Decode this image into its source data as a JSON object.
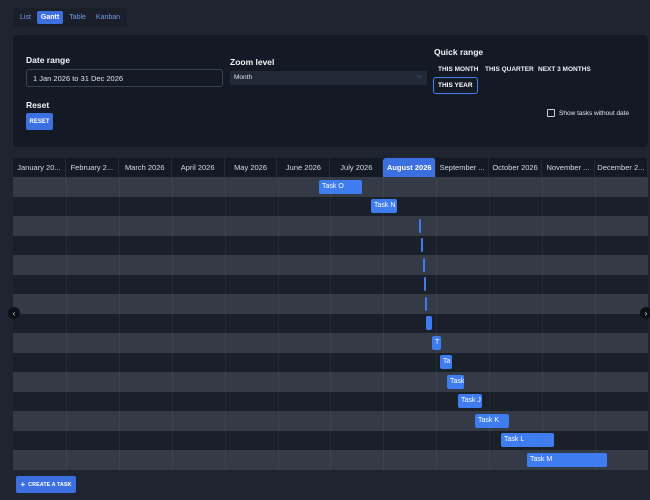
{
  "view_tabs": [
    {
      "label": "List",
      "active": false
    },
    {
      "label": "Gantt",
      "active": true
    },
    {
      "label": "Table",
      "active": false
    },
    {
      "label": "Kanban",
      "active": false
    }
  ],
  "controls": {
    "date_range_label": "Date range",
    "date_range_value": "1 Jan 2026 to 31 Dec 2026",
    "zoom_label": "Zoom level",
    "zoom_value": "Month",
    "quick_range_label": "Quick range",
    "quick_ranges": [
      "THIS MONTH",
      "THIS QUARTER",
      "NEXT 3 MONTHS",
      "THIS YEAR"
    ],
    "quick_range_selected": "THIS YEAR",
    "reset_label": "Reset",
    "reset_button": "RESET",
    "show_tasks_without_date": "Show tasks without date"
  },
  "gantt": {
    "months": [
      "January 20...",
      "February 2...",
      "March 2026",
      "April 2026",
      "May 2026",
      "June 2026",
      "July 2026",
      "August 2026",
      "September ...",
      "October 2026",
      "November ...",
      "December 2..."
    ],
    "current_month": "August 2026",
    "tasks": [
      {
        "label": "Task O"
      },
      {
        "label": "Task N"
      },
      {
        "label": ""
      },
      {
        "label": ""
      },
      {
        "label": ""
      },
      {
        "label": ""
      },
      {
        "label": ""
      },
      {
        "label": ""
      },
      {
        "label": "T"
      },
      {
        "label": "Ta"
      },
      {
        "label": "Task"
      },
      {
        "label": "Task J"
      },
      {
        "label": "Task K"
      },
      {
        "label": "Task L"
      },
      {
        "label": "Task M"
      }
    ]
  },
  "create_task_button": "CREATE A TASK",
  "colors": {
    "accent": "#3c6fe0",
    "bar": "#3f7cf0",
    "background": "#1f2530",
    "panel": "#141a25"
  },
  "icons": {
    "left": "chevron-left-icon",
    "right": "chevron-right-icon",
    "zoom": "chevron-down-icon",
    "add": "plus-icon"
  }
}
